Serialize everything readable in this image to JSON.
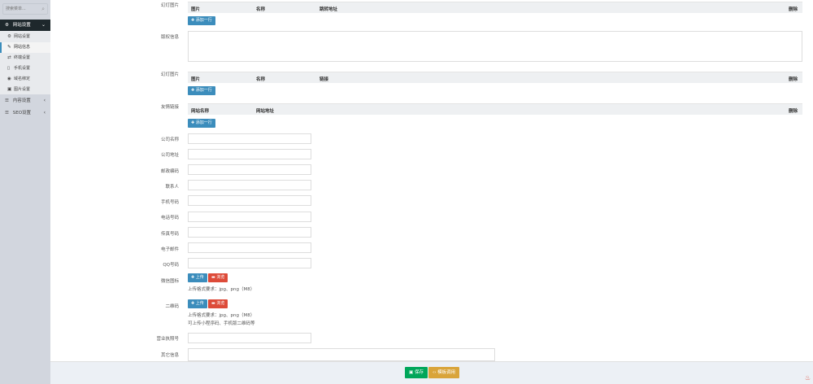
{
  "sidebar": {
    "search_placeholder": "搜索菜单...",
    "menu": [
      {
        "label": "网站设置",
        "icon": "⚙",
        "chev": "⌄"
      },
      {
        "label": "内容设置",
        "icon": "☰",
        "chev": "‹"
      },
      {
        "label": "SEO设置",
        "icon": "☰",
        "chev": "‹"
      }
    ],
    "submenu": [
      {
        "label": "网站设置",
        "icon": "⚙"
      },
      {
        "label": "网站信息",
        "icon": "✎"
      },
      {
        "label": "终端设置",
        "icon": "⇄"
      },
      {
        "label": "手机设置",
        "icon": "▯"
      },
      {
        "label": "域名绑定",
        "icon": "◉"
      },
      {
        "label": "图片设置",
        "icon": "▣"
      }
    ]
  },
  "form": {
    "slides1": {
      "label": "幻灯图片",
      "cols": [
        "图片",
        "名称",
        "跳转地址",
        "删除"
      ],
      "add_label": "✚ 添加一行"
    },
    "copyright": {
      "label": "版权信息"
    },
    "slides2": {
      "label": "幻灯图片",
      "cols": [
        "图片",
        "名称",
        "链接",
        "删除"
      ],
      "add_label": "✚ 添加一行"
    },
    "links": {
      "label": "友情链接",
      "cols": [
        "网站名称",
        "网站地址",
        "删除"
      ],
      "add_label": "✚ 添加一行"
    },
    "company_name": "公司名称",
    "company_address": "公司地址",
    "postcode": "邮政编码",
    "contact": "联系人",
    "mobile": "手机号码",
    "phone": "电话号码",
    "fax": "传真号码",
    "email": "电子邮件",
    "qq": "QQ号码",
    "wechat": {
      "label": "微信图标",
      "upload": "✚ 上传",
      "browse": "▬ 浏览",
      "hint": "上传格式要求：jpg、png（M8）"
    },
    "qrcode": {
      "label": "二维码",
      "upload": "✚ 上传",
      "browse": "▬ 浏览",
      "hint": "上传格式要求：jpg、png（M8）",
      "hint2": "可上传小程序码、手机版二维码等"
    },
    "license": "营业执照号",
    "other": "其它信息"
  },
  "footer": {
    "save": "▣ 保存",
    "code": "‹› 模板调用"
  },
  "colors": {
    "primary": "#3c8dbc",
    "danger": "#dd4b39",
    "success": "#00a65a",
    "warning": "#d9a43a",
    "sidebar_dark": "#1e282c"
  }
}
